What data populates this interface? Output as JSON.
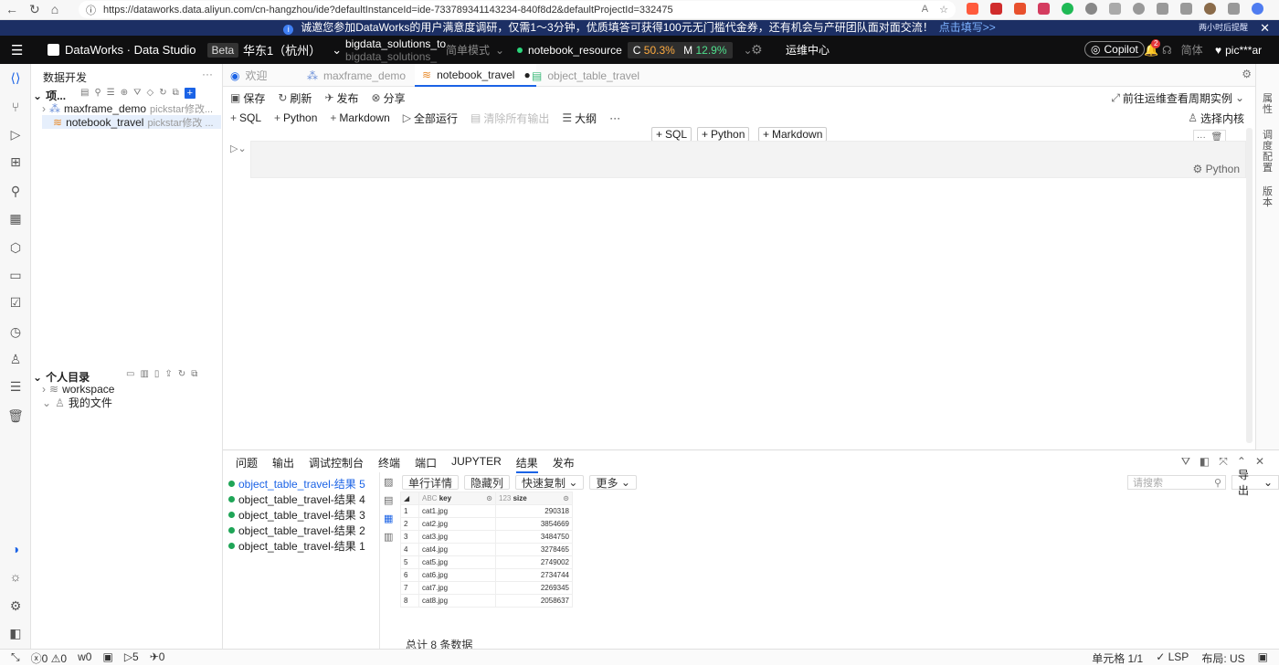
{
  "browser": {
    "url": "https://dataworks.data.aliyun.com/cn-hangzhou/ide?defaultInstanceId=ide-733789341143234-840f8d2&defaultProjectId=332475"
  },
  "banner": {
    "text": "诚邀您参加DataWorks的用户满意度调研，仅需1～3分钟，优质填答可获得100元无门槛代金券，还有机会与产研团队面对面交流！",
    "link": "点击填写>>",
    "later": "两小时后提醒"
  },
  "topbar": {
    "product": "DataWorks · Data Studio",
    "beta": "Beta",
    "region": "华东1（杭州）",
    "workspace_line1": "bigdata_solutions_to",
    "workspace_line2": "bigdata_solutions_",
    "mode": "简单模式",
    "resource": "notebook_resource",
    "cpu_label": "C",
    "cpu_value": "50.3%",
    "mem_label": "M",
    "mem_value": "12.9%",
    "ops": "运维中心",
    "copilot": "Copilot",
    "notif_count": "2",
    "lang": "简体",
    "user": "pic***ar"
  },
  "side": {
    "title": "数据开发",
    "section1": "项...",
    "items": [
      {
        "name": "maxframe_demo",
        "meta": "pickstar修改..."
      },
      {
        "name": "notebook_travel",
        "meta": "pickstar修改 ..."
      }
    ],
    "section2": "个人目录",
    "personal": [
      {
        "name": "workspace"
      },
      {
        "name": "我的文件"
      }
    ]
  },
  "tabs": [
    {
      "label": "欢迎"
    },
    {
      "label": "maxframe_demo"
    },
    {
      "label": "notebook_travel"
    },
    {
      "label": "object_table_travel"
    }
  ],
  "toolbar": {
    "save": "保存",
    "refresh": "刷新",
    "publish": "发布",
    "share": "分享",
    "ops_link": "前往运维查看周期实例"
  },
  "celltoolbar": {
    "sql": "SQL",
    "python": "Python",
    "markdown": "Markdown",
    "run_all": "全部运行",
    "clear": "清除所有输出",
    "outline": "大纲",
    "kernel": "选择内核"
  },
  "cell": {
    "add_sql": "SQL",
    "add_python": "Python",
    "add_markdown": "Markdown",
    "language": "Python"
  },
  "rail": [
    "属性",
    "调度配置",
    "版本"
  ],
  "panel": {
    "tabs": [
      "问题",
      "输出",
      "调试控制台",
      "终端",
      "端口",
      "JUPYTER",
      "结果",
      "发布"
    ],
    "active_tab": "结果",
    "results": [
      "object_table_travel-结果 5",
      "object_table_travel-结果 4",
      "object_table_travel-结果 3",
      "object_table_travel-结果 2",
      "object_table_travel-结果 1"
    ],
    "buttons": {
      "row_detail": "单行详情",
      "hide_cols": "隐藏列",
      "quick_copy": "快速复制",
      "more": "更多"
    },
    "search_placeholder": "请搜索",
    "export": "导出",
    "columns": [
      "key",
      "size"
    ],
    "rows": [
      [
        "1",
        "cat1.jpg",
        "290318"
      ],
      [
        "2",
        "cat2.jpg",
        "3854669"
      ],
      [
        "3",
        "cat3.jpg",
        "3484750"
      ],
      [
        "4",
        "cat4.jpg",
        "3278465"
      ],
      [
        "5",
        "cat5.jpg",
        "2749002"
      ],
      [
        "6",
        "cat6.jpg",
        "2734744"
      ],
      [
        "7",
        "cat7.jpg",
        "2269345"
      ],
      [
        "8",
        "cat8.jpg",
        "2058637"
      ]
    ],
    "total": "总计 8 条数据"
  },
  "status": {
    "errors": "0",
    "warnings": "0",
    "ports": "0",
    "running": "5",
    "published": "0",
    "cell": "单元格 1/1",
    "lsp": "LSP",
    "layout": "布局: US"
  },
  "colors": {
    "accent": "#1b63e6",
    "topbar": "#0f0f10",
    "banner": "#1c2f64"
  }
}
